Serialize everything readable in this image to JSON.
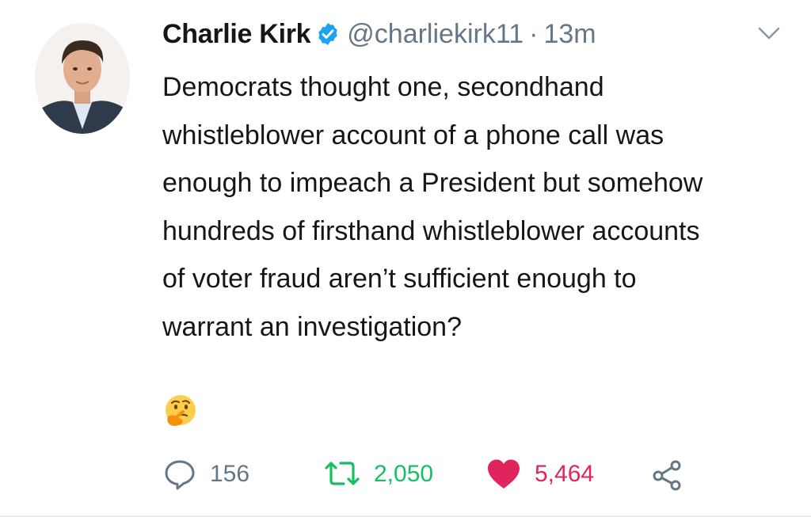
{
  "tweet": {
    "author_name": "Charlie Kirk",
    "verified": true,
    "handle": "@charliekirk11",
    "separator": "·",
    "time": "13m",
    "text_lines": [
      "Democrats thought one, secondhand",
      "whistleblower account of a phone call was",
      "enough to impeach a President but somehow",
      "hundreds of firsthand whistleblower accounts",
      "of voter fraud aren’t sufficient enough to",
      "warrant an investigation?"
    ],
    "emoji": "thinking-face"
  },
  "actions": {
    "reply_count": "156",
    "retweet_count": "2,050",
    "like_count": "5,464"
  },
  "colors": {
    "text": "#14171a",
    "secondary": "#657786",
    "verified_blue": "#1da1f2",
    "retweet_green": "#17bf63",
    "like_red": "#e0245e"
  }
}
